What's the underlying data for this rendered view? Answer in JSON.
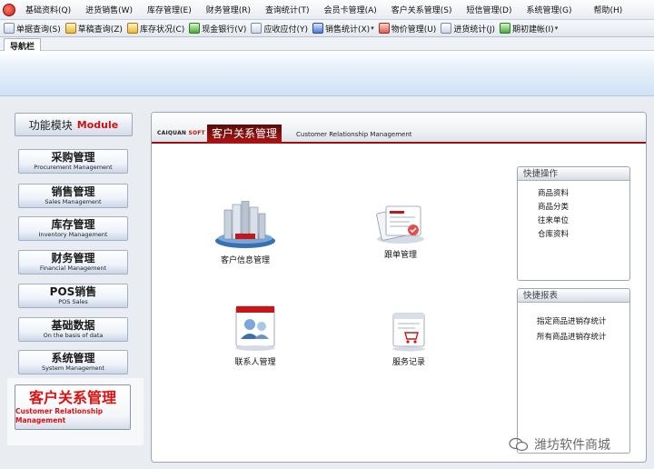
{
  "menu": [
    "基础资料(Q)",
    "进货销售(W)",
    "库存管理(E)",
    "财务管理(R)",
    "查询统计(T)",
    "会员卡管理(A)",
    "客户关系管理(S)",
    "短信管理(D)",
    "系统管理(G)",
    "帮助(H)"
  ],
  "toolbar": [
    {
      "label": "单据查询(S)",
      "icon": "document-search-icon"
    },
    {
      "label": "草稿查询(Z)",
      "icon": "draft-icon"
    },
    {
      "label": "库存状况(C)",
      "icon": "inventory-icon"
    },
    {
      "label": "现金银行(V)",
      "icon": "bank-icon"
    },
    {
      "label": "应收应付(Y)",
      "icon": "receivable-icon"
    },
    {
      "label": "销售统计(X)",
      "icon": "sales-stats-icon",
      "dropdown": true
    },
    {
      "label": "物价管理(U)",
      "icon": "price-icon"
    },
    {
      "label": "进货统计(J)",
      "icon": "purchase-stats-icon"
    },
    {
      "label": "期初建帐(I)",
      "icon": "opening-account-icon",
      "dropdown": true
    }
  ],
  "navbar": {
    "label": "导航栏"
  },
  "modules": {
    "title_cn": "功能模块",
    "title_en": "Module",
    "items": [
      {
        "cn": "采购管理",
        "en": "Procurement Management"
      },
      {
        "cn": "销售管理",
        "en": "Sales Management"
      },
      {
        "cn": "库存管理",
        "en": "Inventory Management"
      },
      {
        "cn": "财务管理",
        "en": "Financial Management"
      },
      {
        "cn": "POS销售",
        "en": "POS Sales"
      },
      {
        "cn": "基础数据",
        "en": "On the basis of data"
      },
      {
        "cn": "系统管理",
        "en": "System Management"
      },
      {
        "cn": "客户关系管理",
        "en": "Customer Relationship Management",
        "active": true
      }
    ]
  },
  "panel": {
    "brand_black": "CAIQUAN",
    "brand_red": "SOFT",
    "title_cn": "客户关系管理",
    "title_en": "Customer Relationship Management",
    "features": [
      {
        "label": "客户信息管理",
        "icon": "customer-info-icon"
      },
      {
        "label": "跟单管理",
        "icon": "order-tracking-icon"
      },
      {
        "label": "联系人管理",
        "icon": "contacts-icon"
      },
      {
        "label": "服务记录",
        "icon": "service-record-icon"
      }
    ]
  },
  "quick_ops": {
    "title": "快捷操作",
    "items": [
      "商品资料",
      "商品分类",
      "往来单位",
      "仓库资料"
    ]
  },
  "quick_reports": {
    "title": "快捷报表",
    "items": [
      "指定商品进销存统计",
      "所有商品进销存统计"
    ]
  },
  "watermark": {
    "text": "潍坊软件商城"
  },
  "colors": {
    "accent_red": "#d41010",
    "tab_dark_red": "#8a0c0c",
    "panel_blue": "#cfe2f5"
  }
}
